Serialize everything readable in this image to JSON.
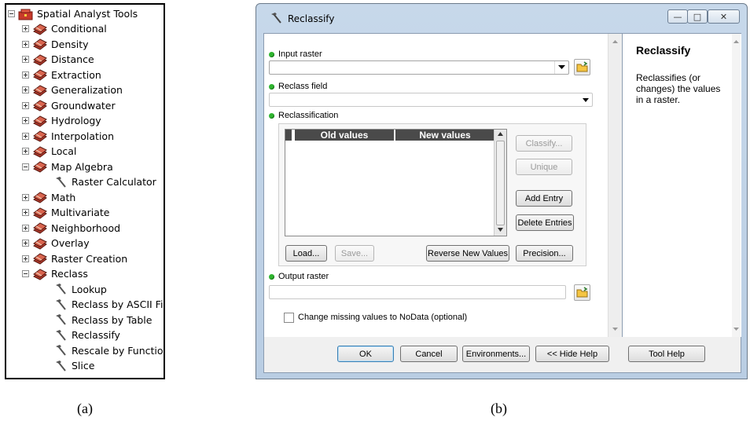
{
  "panel_a": {
    "root": "Spatial Analyst Tools",
    "items": [
      {
        "label": "Conditional",
        "kind": "toolset",
        "state": "collapsed"
      },
      {
        "label": "Density",
        "kind": "toolset",
        "state": "collapsed"
      },
      {
        "label": "Distance",
        "kind": "toolset",
        "state": "collapsed"
      },
      {
        "label": "Extraction",
        "kind": "toolset",
        "state": "collapsed"
      },
      {
        "label": "Generalization",
        "kind": "toolset",
        "state": "collapsed"
      },
      {
        "label": "Groundwater",
        "kind": "toolset",
        "state": "collapsed"
      },
      {
        "label": "Hydrology",
        "kind": "toolset",
        "state": "collapsed"
      },
      {
        "label": "Interpolation",
        "kind": "toolset",
        "state": "collapsed"
      },
      {
        "label": "Local",
        "kind": "toolset",
        "state": "collapsed"
      },
      {
        "label": "Map Algebra",
        "kind": "toolset",
        "state": "expanded"
      },
      {
        "label": "Raster Calculator",
        "kind": "tool"
      },
      {
        "label": "Math",
        "kind": "toolset",
        "state": "collapsed"
      },
      {
        "label": "Multivariate",
        "kind": "toolset",
        "state": "collapsed"
      },
      {
        "label": "Neighborhood",
        "kind": "toolset",
        "state": "collapsed"
      },
      {
        "label": "Overlay",
        "kind": "toolset",
        "state": "collapsed"
      },
      {
        "label": "Raster Creation",
        "kind": "toolset",
        "state": "collapsed"
      },
      {
        "label": "Reclass",
        "kind": "toolset",
        "state": "expanded"
      },
      {
        "label": "Lookup",
        "kind": "tool"
      },
      {
        "label": "Reclass by ASCII File",
        "kind": "tool"
      },
      {
        "label": "Reclass by Table",
        "kind": "tool"
      },
      {
        "label": "Reclassify",
        "kind": "tool"
      },
      {
        "label": "Rescale by Function",
        "kind": "tool"
      },
      {
        "label": "Slice",
        "kind": "tool"
      }
    ],
    "caption": "(a)"
  },
  "panel_b": {
    "window_title": "Reclassify",
    "input_raster_label": "Input raster",
    "input_raster_value": "",
    "reclass_field_label": "Reclass field",
    "reclass_field_value": "",
    "reclassification_label": "Reclassification",
    "table_headers": [
      "Old values",
      "New values"
    ],
    "side_buttons": {
      "classify": "Classify...",
      "unique": "Unique",
      "add_entry": "Add Entry",
      "delete_entries": "Delete Entries"
    },
    "bottom_buttons": {
      "load": "Load...",
      "save": "Save...",
      "reverse": "Reverse New Values",
      "precision": "Precision..."
    },
    "output_raster_label": "Output raster",
    "output_raster_value": "",
    "nodata_checkbox_label": "Change missing values to NoData (optional)",
    "nodata_checked": false,
    "help_title": "Reclassify",
    "help_text": "Reclassifies (or changes) the values in a raster.",
    "footer": {
      "ok": "OK",
      "cancel": "Cancel",
      "environments": "Environments...",
      "hide_help": "<< Hide Help",
      "tool_help": "Tool Help"
    },
    "caption": "(b)"
  },
  "colors": {
    "required_dot": "#2fb52f",
    "toolbox_red": "#c0392b",
    "titlebar": "#c7d8ea"
  }
}
